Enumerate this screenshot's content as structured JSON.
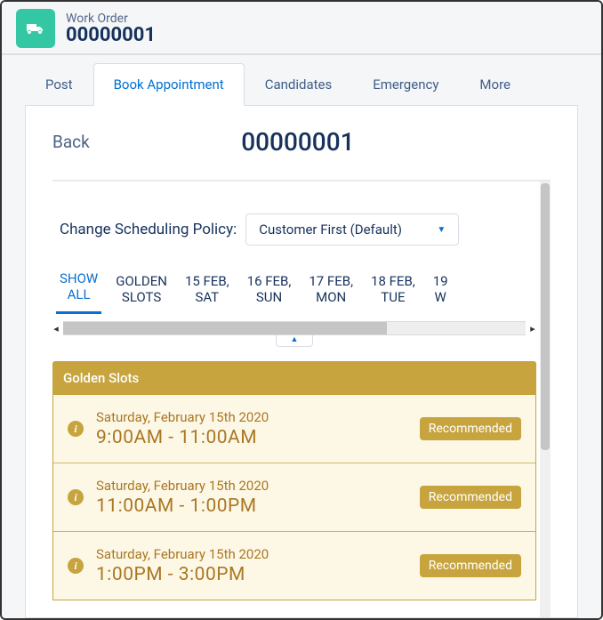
{
  "header": {
    "object_type": "Work Order",
    "record_number": "00000001"
  },
  "tabs": [
    {
      "label": "Post",
      "active": false
    },
    {
      "label": "Book Appointment",
      "active": true
    },
    {
      "label": "Candidates",
      "active": false
    },
    {
      "label": "Emergency",
      "active": false
    },
    {
      "label": "More",
      "active": false
    }
  ],
  "book": {
    "back_label": "Back",
    "title": "00000001",
    "policy_label": "Change Scheduling Policy:",
    "policy_selected": "Customer First (Default)",
    "day_tabs": [
      {
        "line1": "SHOW",
        "line2": "ALL",
        "active": true
      },
      {
        "line1": "GOLDEN",
        "line2": "SLOTS"
      },
      {
        "line1": "15 FEB,",
        "line2": "SAT"
      },
      {
        "line1": "16 FEB,",
        "line2": "SUN"
      },
      {
        "line1": "17 FEB,",
        "line2": "MON"
      },
      {
        "line1": "18 FEB,",
        "line2": "TUE"
      },
      {
        "line1": "19",
        "line2": "W"
      }
    ],
    "group_title": "Golden Slots",
    "recommended_label": "Recommended",
    "slots": [
      {
        "date": "Saturday, February 15th 2020",
        "time": "9:00AM - 11:00AM"
      },
      {
        "date": "Saturday, February 15th 2020",
        "time": "11:00AM - 1:00PM"
      },
      {
        "date": "Saturday, February 15th 2020",
        "time": "1:00PM - 3:00PM"
      }
    ]
  }
}
